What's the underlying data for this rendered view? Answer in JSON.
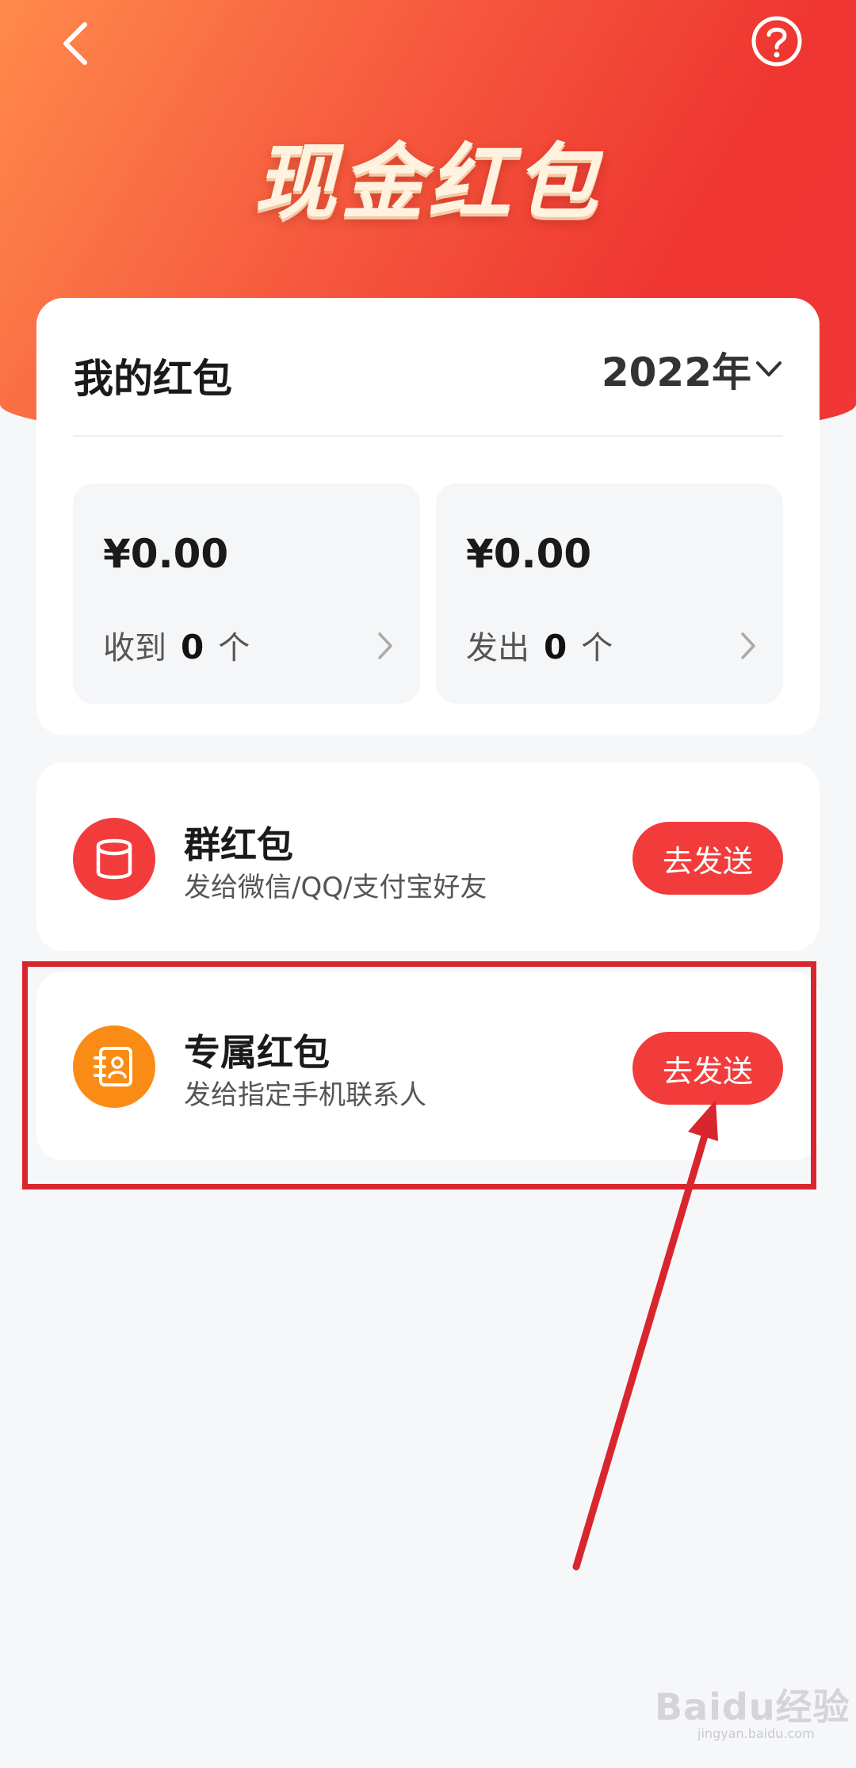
{
  "header": {
    "title": "现金红包",
    "back_icon": "chevron-left-icon",
    "help_icon": "question-circle-icon",
    "gradient_colors": [
      "#ff8a4c",
      "#f65a3e",
      "#ef3531"
    ]
  },
  "summary": {
    "title": "我的红包",
    "year": "2022年",
    "received": {
      "amount": "¥0.00",
      "label": "收到",
      "count": "0",
      "unit": "个"
    },
    "sent": {
      "amount": "¥0.00",
      "label": "发出",
      "count": "0",
      "unit": "个"
    }
  },
  "options": [
    {
      "title": "群红包",
      "description": "发给微信/QQ/支付宝好友",
      "button": "去发送",
      "icon": "cylinder-icon",
      "icon_color": "#f23c3c"
    },
    {
      "title": "专属红包",
      "description": "发给指定手机联系人",
      "button": "去发送",
      "icon": "contact-book-icon",
      "icon_color": "#fa8c16"
    }
  ],
  "annotation": {
    "highlight_color": "#d9262e"
  },
  "watermark": {
    "brand": "Baidu经验",
    "url": "jingyan.baidu.com"
  }
}
